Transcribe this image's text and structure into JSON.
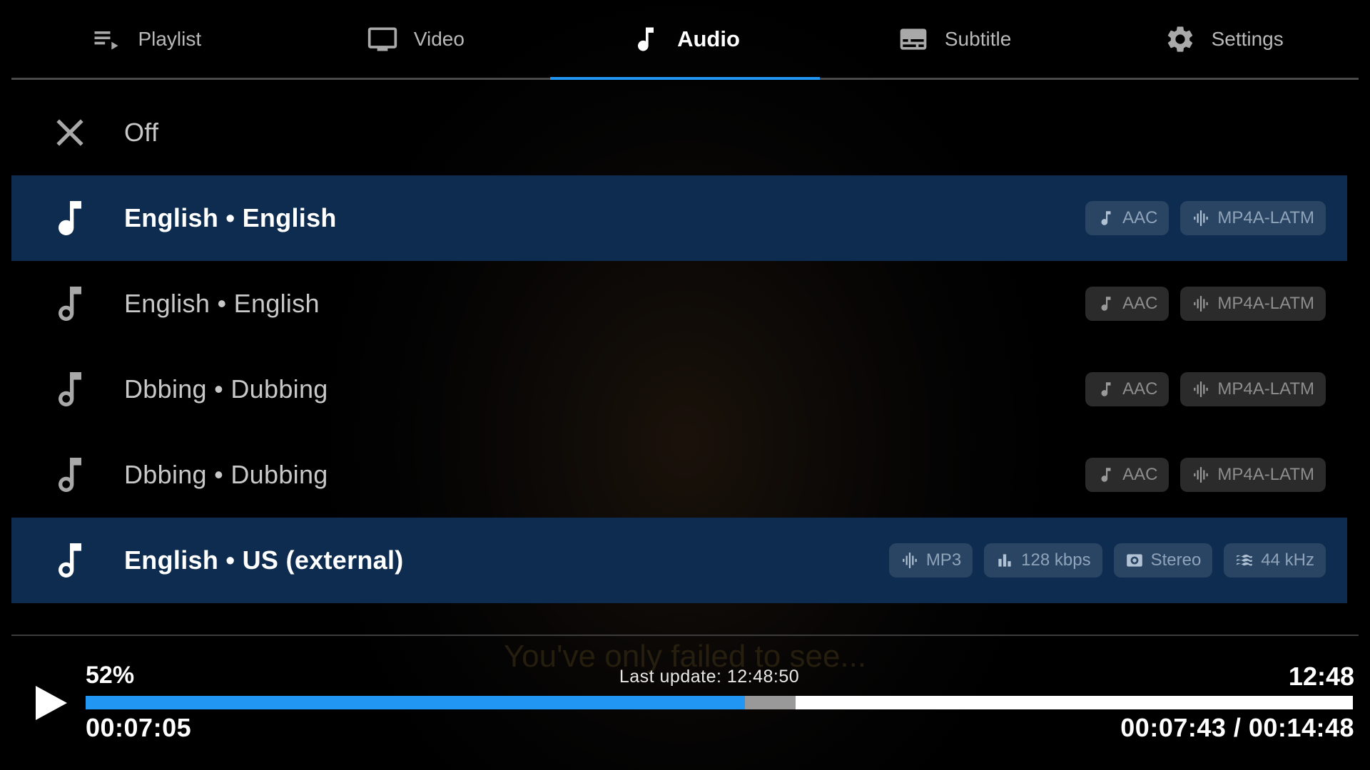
{
  "tabs": [
    {
      "label": "Playlist",
      "icon": "playlist-icon",
      "active": false
    },
    {
      "label": "Video",
      "icon": "monitor-icon",
      "active": false
    },
    {
      "label": "Audio",
      "icon": "music-note-icon",
      "active": true
    },
    {
      "label": "Subtitle",
      "icon": "subtitles-icon",
      "active": false
    },
    {
      "label": "Settings",
      "icon": "gear-icon",
      "active": false
    }
  ],
  "tracks": {
    "off_label": "Off",
    "items": [
      {
        "label": "English • English",
        "selected": true,
        "chips": [
          {
            "icon": "music-note-icon",
            "text": "AAC"
          },
          {
            "icon": "waveform-icon",
            "text": "MP4A-LATM"
          }
        ]
      },
      {
        "label": "English • English",
        "selected": false,
        "chips": [
          {
            "icon": "music-note-icon",
            "text": "AAC"
          },
          {
            "icon": "waveform-icon",
            "text": "MP4A-LATM"
          }
        ]
      },
      {
        "label": "Dbbing • Dubbing",
        "selected": false,
        "chips": [
          {
            "icon": "music-note-icon",
            "text": "AAC"
          },
          {
            "icon": "waveform-icon",
            "text": "MP4A-LATM"
          }
        ]
      },
      {
        "label": "Dbbing • Dubbing",
        "selected": false,
        "chips": [
          {
            "icon": "music-note-icon",
            "text": "AAC"
          },
          {
            "icon": "waveform-icon",
            "text": "MP4A-LATM"
          }
        ]
      },
      {
        "label": "English • US (external)",
        "selected": true,
        "chips": [
          {
            "icon": "waveform-icon",
            "text": "MP3"
          },
          {
            "icon": "bar-chart-icon",
            "text": "128 kbps"
          },
          {
            "icon": "speaker-icon",
            "text": "Stereo"
          },
          {
            "icon": "waves-icon",
            "text": "44 kHz"
          }
        ]
      }
    ]
  },
  "subtitle_text": "You've only failed to see...",
  "player": {
    "percent": "52%",
    "last_update": "Last update: 12:48:50",
    "clock": "12:48",
    "elapsed": "00:07:05",
    "position": "00:07:43 / 00:14:48",
    "played_fraction": 0.52,
    "buffered_fraction": 0.56
  },
  "colors": {
    "accent": "#2196f3",
    "selected_row": "#0e2c4f"
  }
}
